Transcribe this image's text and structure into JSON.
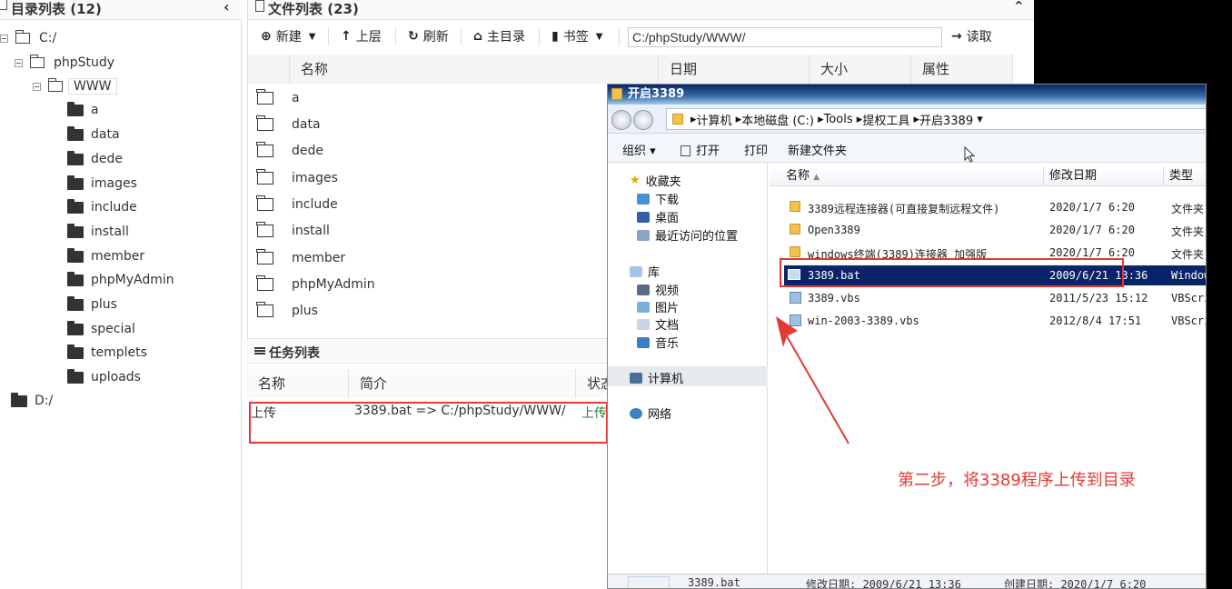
{
  "dir_panel": {
    "title": "目录列表 (12)",
    "collapse_icon": "chevron-left-icon",
    "root_c": "C:/",
    "phpstudy": "phpStudy",
    "www": "WWW",
    "folders": [
      "a",
      "data",
      "dede",
      "images",
      "include",
      "install",
      "member",
      "phpMyAdmin",
      "plus",
      "special",
      "templets",
      "uploads"
    ],
    "root_d": "D:/"
  },
  "file_panel": {
    "title": "文件列表 (23)",
    "collapse_icon": "chevron-up-icon",
    "toolbar": {
      "new": "新建",
      "up": "上层",
      "refresh": "刷新",
      "home": "主目录",
      "bookmark": "书签",
      "path": "C:/phpStudy/WWW/",
      "read": "读取"
    },
    "columns": [
      "名称",
      "日期",
      "大小",
      "属性"
    ],
    "files": [
      "a",
      "data",
      "dede",
      "images",
      "include",
      "install",
      "member",
      "phpMyAdmin",
      "plus"
    ]
  },
  "task_panel": {
    "title": "任务列表",
    "columns": [
      "名称",
      "简介",
      "状态"
    ],
    "row": {
      "name": "上传",
      "desc": "3389.bat => C:/phpStudy/WWW/",
      "status": "上传"
    }
  },
  "explorer": {
    "title": "开启3389",
    "breadcrumb": [
      "计算机",
      "本地磁盘 (C:)",
      "Tools",
      "提权工具",
      "开启3389"
    ],
    "commands": [
      "组织",
      "打开",
      "打印",
      "新建文件夹"
    ],
    "nav": {
      "favorites": "收藏夹",
      "downloads": "下载",
      "desktop": "桌面",
      "recent": "最近访问的位置",
      "libraries": "库",
      "videos": "视频",
      "pictures": "图片",
      "documents": "文档",
      "music": "音乐",
      "computer": "计算机",
      "network": "网络"
    },
    "columns": [
      "名称",
      "修改日期",
      "类型"
    ],
    "rows": [
      {
        "name": "3389远程连接器(可直接复制远程文件)",
        "date": "2020/1/7 6:20",
        "type": "文件夹"
      },
      {
        "name": "Open3389",
        "date": "2020/1/7 6:20",
        "type": "文件夹"
      },
      {
        "name": "windows终端(3389)连接器 加强版",
        "date": "2020/1/7 6:20",
        "type": "文件夹"
      },
      {
        "name": "3389.bat",
        "date": "2009/6/21 13:36",
        "type": "Windows"
      },
      {
        "name": "3389.vbs",
        "date": "2011/5/23 15:12",
        "type": "VBScript"
      },
      {
        "name": "win-2003-3389.vbs",
        "date": "2012/8/4 17:51",
        "type": "VBScript"
      }
    ],
    "status": {
      "file": "3389.bat",
      "modified": "修改日期: 2009/6/21 13:36",
      "created": "创建日期: 2020/1/7 6:20"
    }
  },
  "annotation": "第二步，将3389程序上传到目录",
  "colors": {
    "annotation_red": "#e53935",
    "selection_blue": "#0a246a"
  }
}
